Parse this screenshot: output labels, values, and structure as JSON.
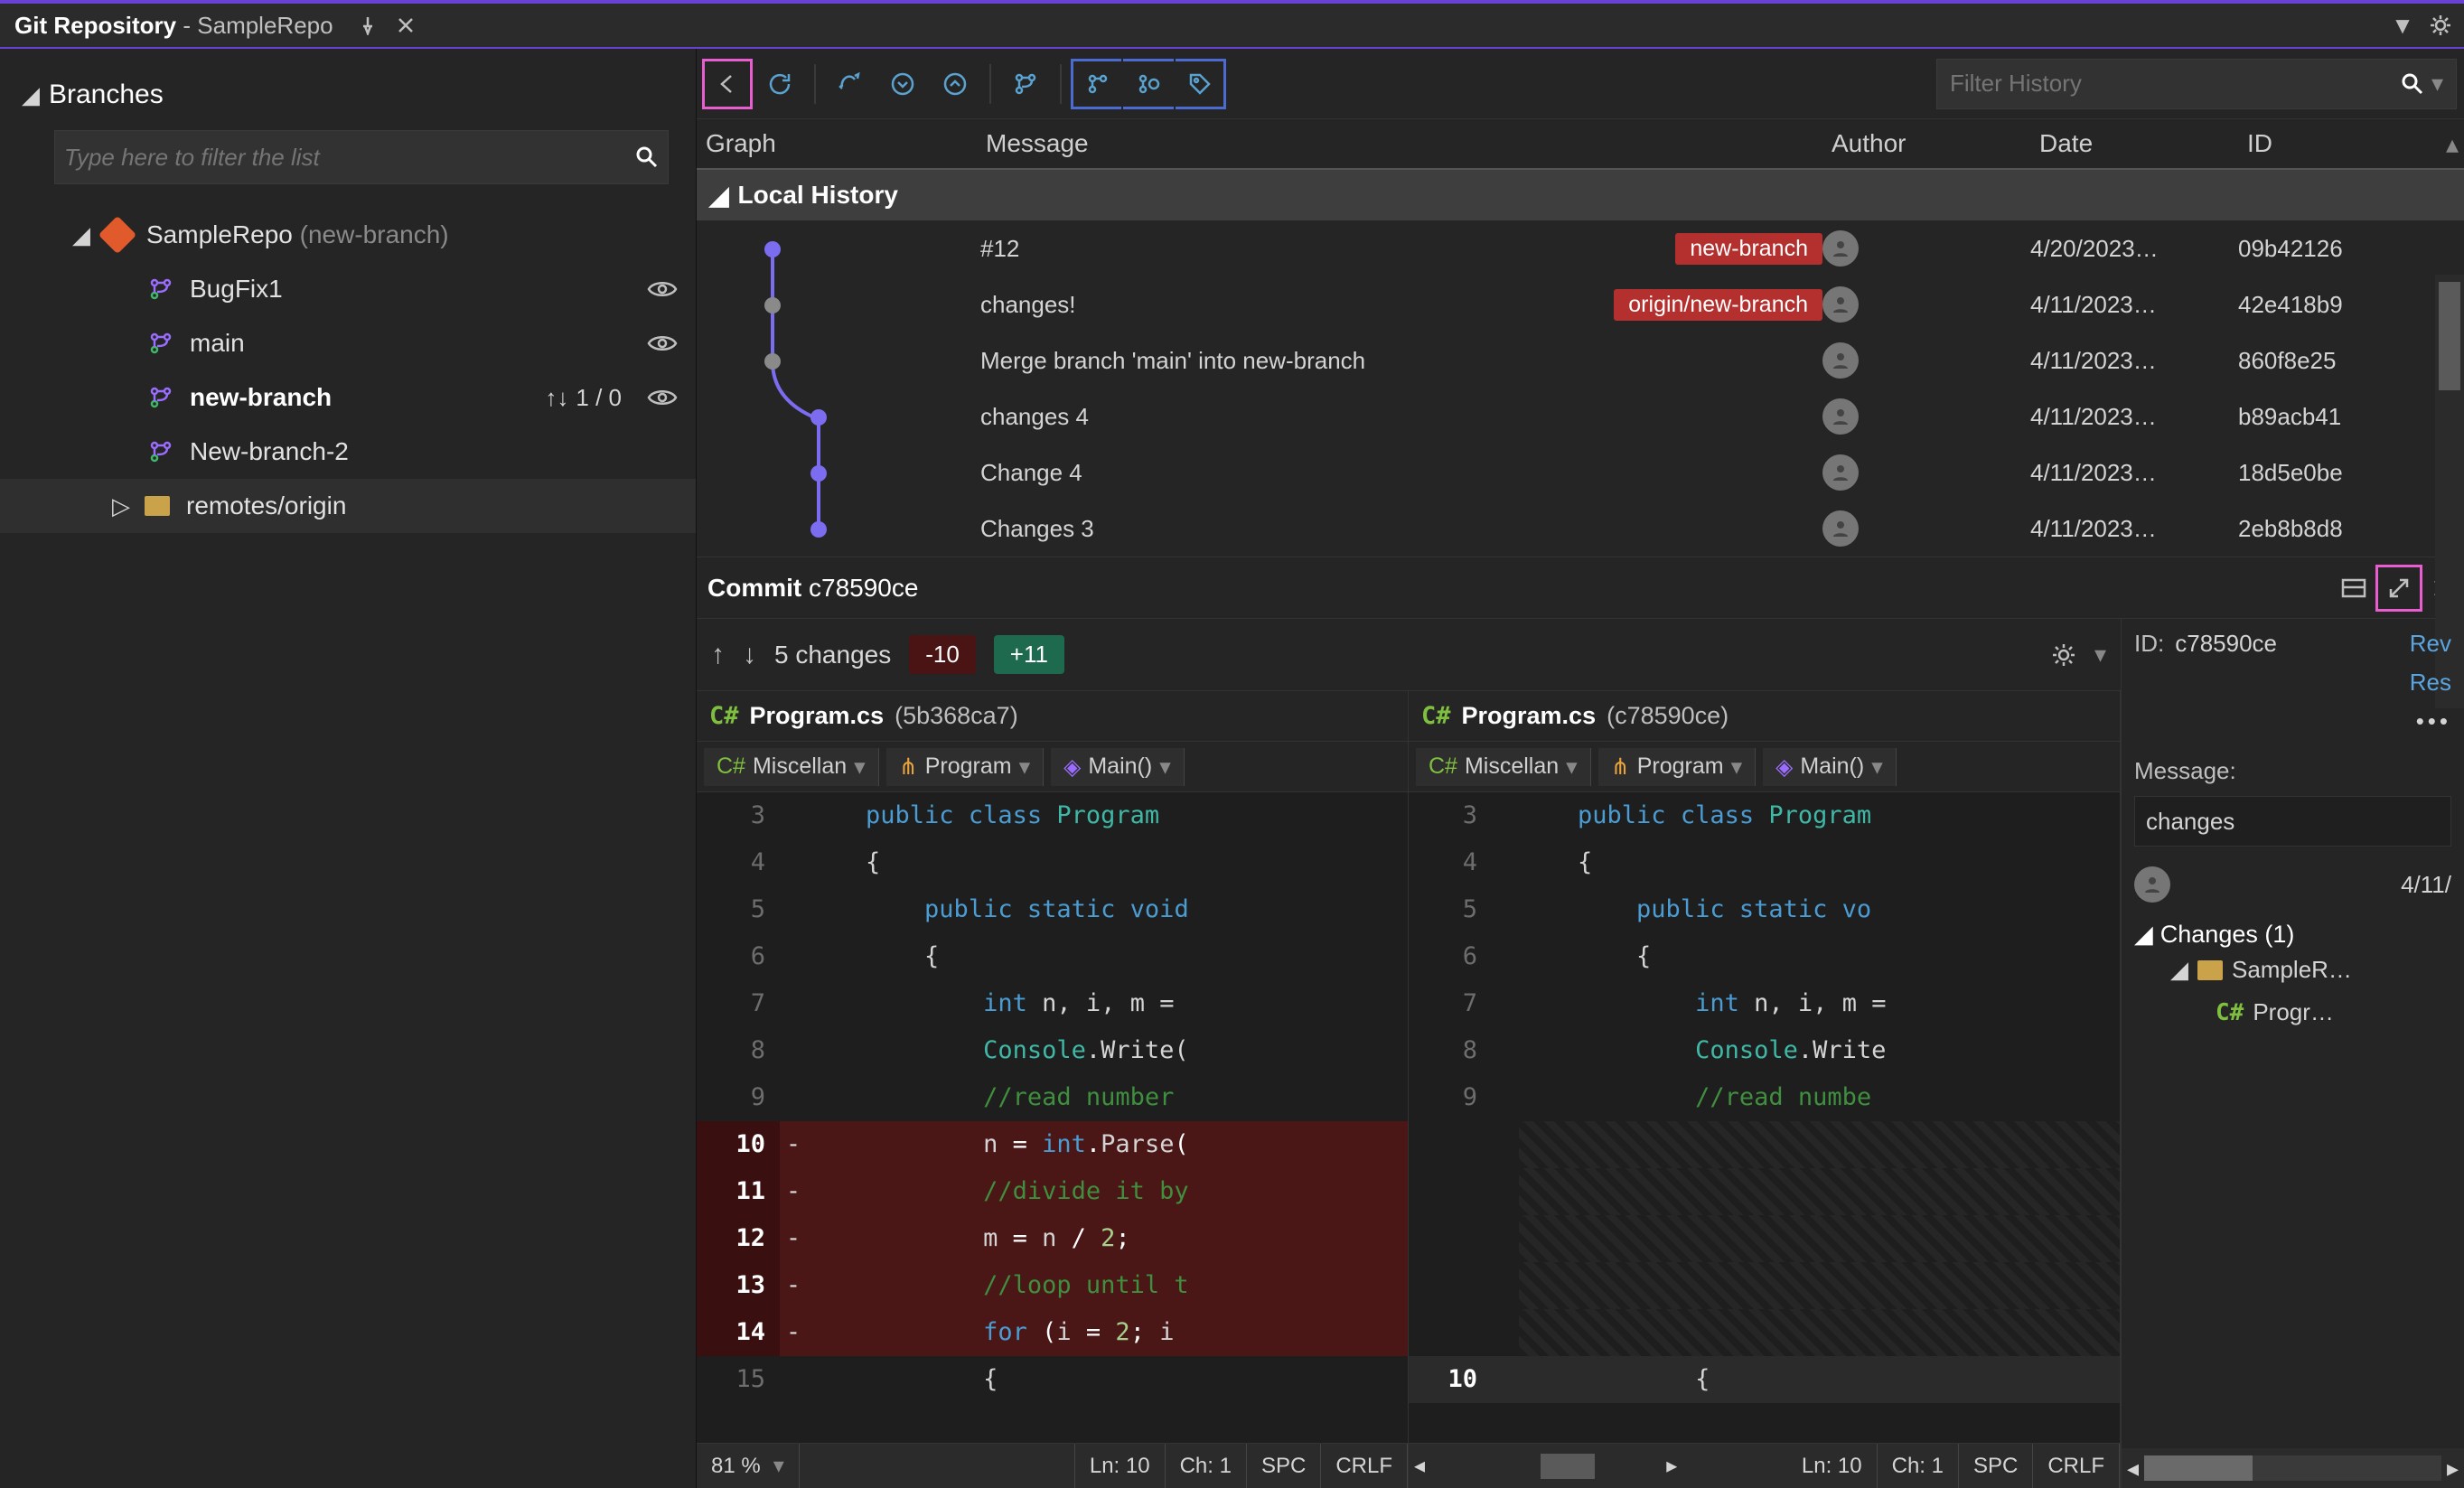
{
  "titlebar": {
    "app": "Git Repository",
    "repo": "SampleRepo"
  },
  "sidebar": {
    "branches_header": "Branches",
    "filter_placeholder": "Type here to filter the list",
    "repo_name": "SampleRepo",
    "repo_branch_suffix": "(new-branch)",
    "items": [
      {
        "name": "BugFix1",
        "current": false,
        "ahead_behind": "",
        "watch": true
      },
      {
        "name": "main",
        "current": false,
        "ahead_behind": "",
        "watch": true
      },
      {
        "name": "new-branch",
        "current": true,
        "ahead_behind": "1 / 0",
        "watch": true
      },
      {
        "name": "New-branch-2",
        "current": false,
        "ahead_behind": "",
        "watch": false
      }
    ],
    "remotes_label": "remotes/origin"
  },
  "history": {
    "filter_placeholder": "Filter History",
    "columns": {
      "graph": "Graph",
      "message": "Message",
      "author": "Author",
      "date": "Date",
      "id": "ID"
    },
    "section": "Local History",
    "commits": [
      {
        "message": "#12",
        "badge": "new-branch",
        "badge_origin": "",
        "date": "4/20/2023…",
        "id": "09b42126"
      },
      {
        "message": "changes!",
        "badge": "",
        "badge_origin": "origin/new-branch",
        "date": "4/11/2023…",
        "id": "42e418b9"
      },
      {
        "message": "Merge branch 'main' into new-branch",
        "badge": "",
        "badge_origin": "",
        "date": "4/11/2023…",
        "id": "860f8e25"
      },
      {
        "message": "changes 4",
        "badge": "",
        "badge_origin": "",
        "date": "4/11/2023…",
        "id": "b89acb41"
      },
      {
        "message": "Change 4",
        "badge": "",
        "badge_origin": "",
        "date": "4/11/2023…",
        "id": "18d5e0be"
      },
      {
        "message": "Changes 3",
        "badge": "",
        "badge_origin": "",
        "date": "4/11/2023…",
        "id": "2eb8b8d8"
      }
    ]
  },
  "commit_detail": {
    "header_prefix": "Commit",
    "header_id": "c78590ce",
    "changes_label": "5 changes",
    "deletions": "-10",
    "insertions": "+11",
    "id_label": "ID:",
    "id_value": "c78590ce",
    "rev_link": "Rev",
    "res_link": "Res",
    "message_label": "Message:",
    "message_value": "changes",
    "date_short": "4/11/",
    "changes_tree_header": "Changes (1)",
    "changes_folder": "SampleR…",
    "changes_file": "Progr…"
  },
  "diff": {
    "left": {
      "filename": "Program.cs",
      "rev": "(5b368ca7)"
    },
    "right": {
      "filename": "Program.cs",
      "rev": "(c78590ce)"
    },
    "crumbs": {
      "project": "Miscellan",
      "class": "Program",
      "method": "Main()"
    }
  },
  "statusbar": {
    "zoom": "81 %",
    "ln": "Ln: 10",
    "ch": "Ch: 1",
    "spc": "SPC",
    "crlf": "CRLF",
    "ln_r": "Ln: 10",
    "ch_r": "Ch: 1",
    "spc_r": "SPC",
    "crlf_r": "CRLF"
  }
}
